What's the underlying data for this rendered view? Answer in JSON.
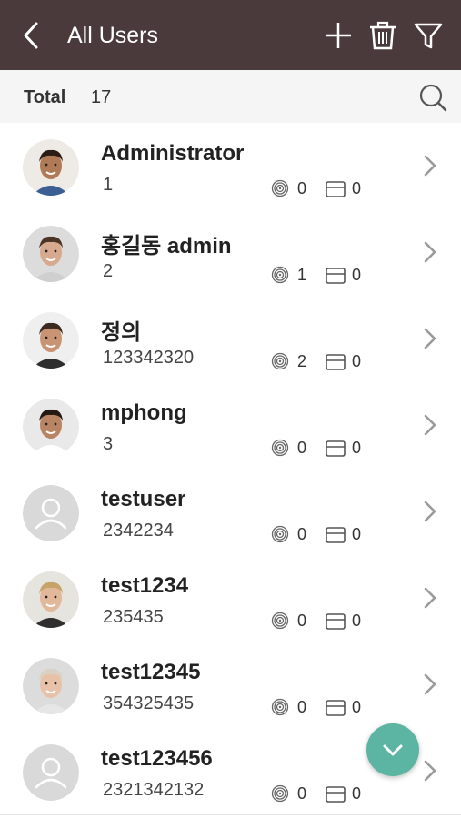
{
  "header": {
    "title": "All Users"
  },
  "summary": {
    "total_label": "Total",
    "total_count": "17"
  },
  "users": [
    {
      "name": "Administrator",
      "id": "1",
      "fingerprints": "0",
      "cards": "0",
      "avatar": "photo"
    },
    {
      "name": "홍길동 admin",
      "id": "2",
      "fingerprints": "1",
      "cards": "0",
      "avatar": "photo"
    },
    {
      "name": "정의",
      "id": "123342320",
      "fingerprints": "2",
      "cards": "0",
      "avatar": "photo"
    },
    {
      "name": "mphong",
      "id": "3",
      "fingerprints": "0",
      "cards": "0",
      "avatar": "photo"
    },
    {
      "name": "testuser",
      "id": "2342234",
      "fingerprints": "0",
      "cards": "0",
      "avatar": "placeholder"
    },
    {
      "name": "test1234",
      "id": "235435",
      "fingerprints": "0",
      "cards": "0",
      "avatar": "photo"
    },
    {
      "name": "test12345",
      "id": "354325435",
      "fingerprints": "0",
      "cards": "0",
      "avatar": "photo"
    },
    {
      "name": "test123456",
      "id": "2321342132",
      "fingerprints": "0",
      "cards": "0",
      "avatar": "placeholder"
    }
  ],
  "colors": {
    "header_bg": "#4a3a3b",
    "fab_bg": "#5bb5a2",
    "total_bar_bg": "#f5f5f5"
  },
  "icons": [
    "back-arrow-icon",
    "add-icon",
    "trash-icon",
    "filter-icon",
    "search-icon",
    "fingerprint-icon",
    "card-icon",
    "chevron-right-icon",
    "chevron-down-icon",
    "user-placeholder-icon"
  ]
}
